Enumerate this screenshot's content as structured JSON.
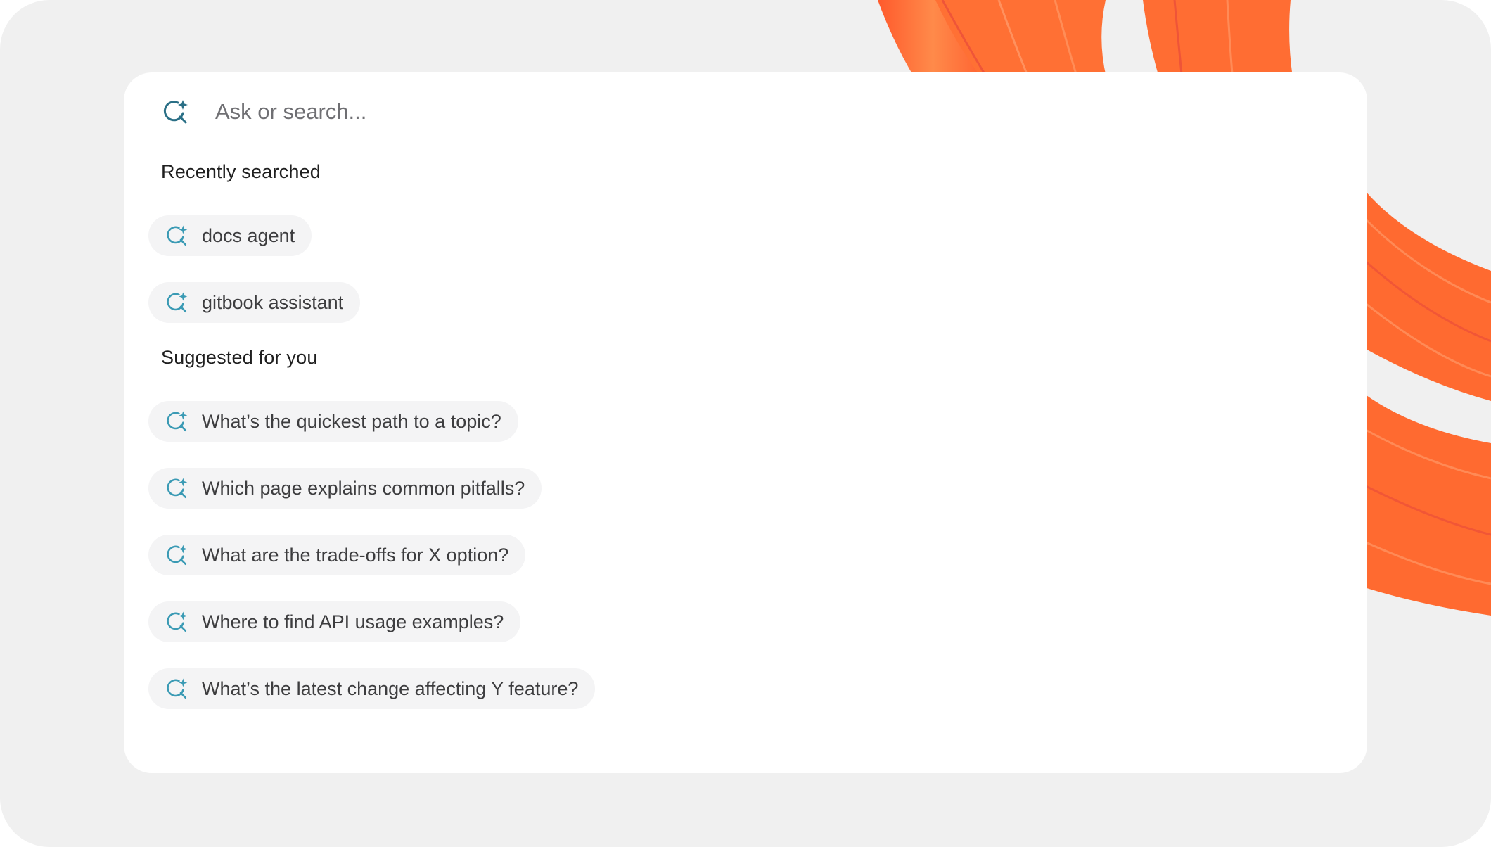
{
  "search": {
    "placeholder": "Ask or search...",
    "icon": "ai-search-icon"
  },
  "recent": {
    "heading": "Recently searched",
    "items": [
      {
        "label": "docs agent"
      },
      {
        "label": "gitbook assistant"
      }
    ]
  },
  "suggested": {
    "heading": "Suggested for you",
    "items": [
      {
        "label": "What’s the quickest path to a topic?"
      },
      {
        "label": "Which page explains common pitfalls?"
      },
      {
        "label": "What are the trade-offs for X option?"
      },
      {
        "label": "Where to find API usage examples?"
      },
      {
        "label": "What’s the latest change affecting Y feature?"
      }
    ]
  },
  "colors": {
    "accent_icon": "#2f8fa8",
    "ribbon": "#ff6a33",
    "background": "#f0f0f0",
    "panel": "#ffffff",
    "chip": "#f4f4f5"
  }
}
